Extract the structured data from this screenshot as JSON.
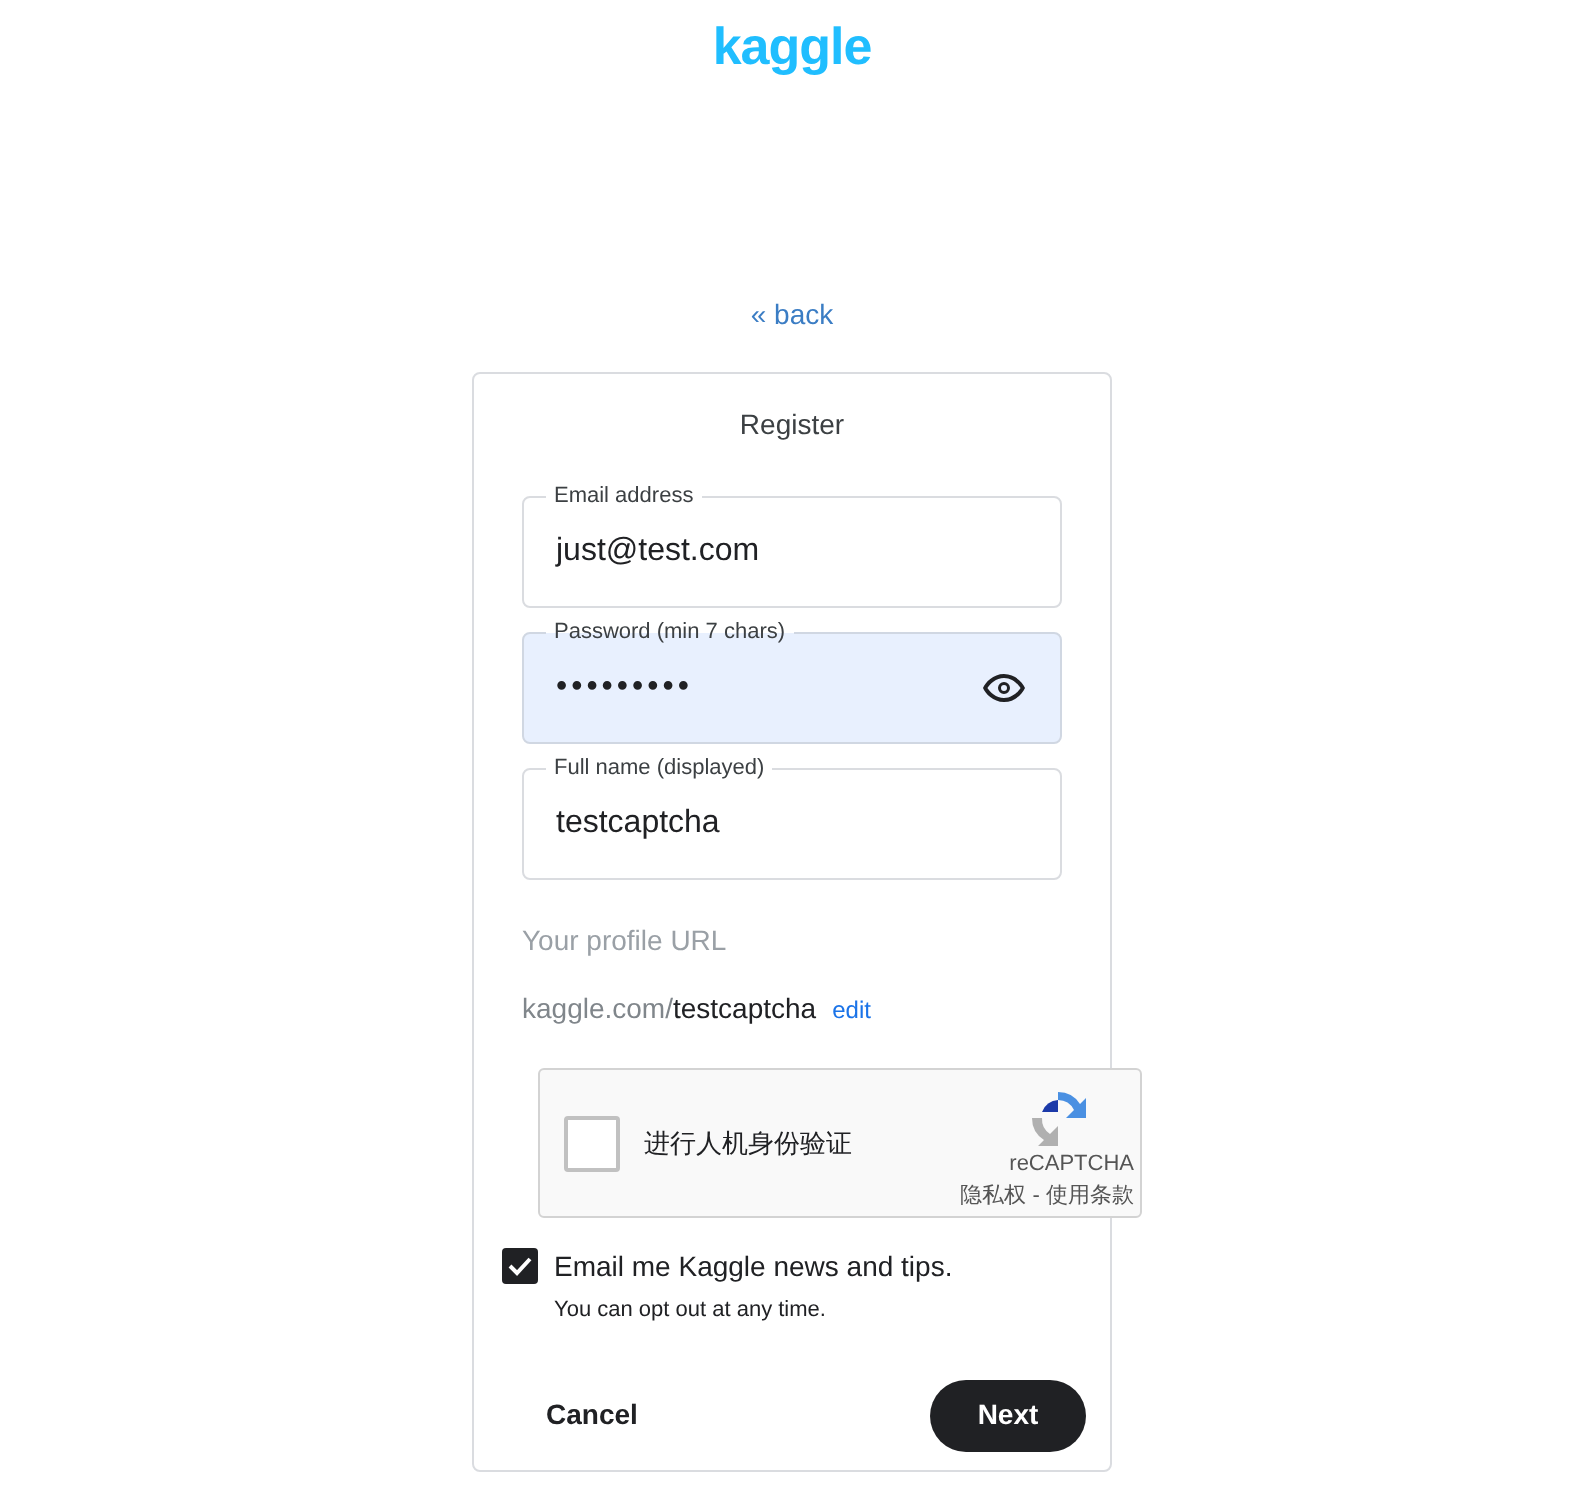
{
  "logo": "kaggle",
  "back_link": "« back",
  "card": {
    "title": "Register",
    "fields": [
      {
        "label": "Email address",
        "value": "just@test.com",
        "highlighted": false,
        "kind": "text"
      },
      {
        "label": "Password (min 7 chars)",
        "value": "•••••••••",
        "highlighted": true,
        "kind": "password"
      },
      {
        "label": "Full name (displayed)",
        "value": "testcaptcha",
        "highlighted": false,
        "kind": "text"
      }
    ],
    "profile_url": {
      "label": "Your profile URL",
      "prefix": "kaggle.com/",
      "slug": "testcaptcha",
      "edit": "edit"
    },
    "captcha": {
      "checked": false,
      "label": "进行人机身份验证",
      "brand": "reCAPTCHA",
      "privacy": "隐私权",
      "separator": " - ",
      "terms": "使用条款"
    },
    "newsletter": {
      "checked": true,
      "label": "Email me Kaggle news and tips.",
      "note": "You can opt out at any time."
    },
    "buttons": {
      "cancel": "Cancel",
      "next": "Next"
    }
  }
}
